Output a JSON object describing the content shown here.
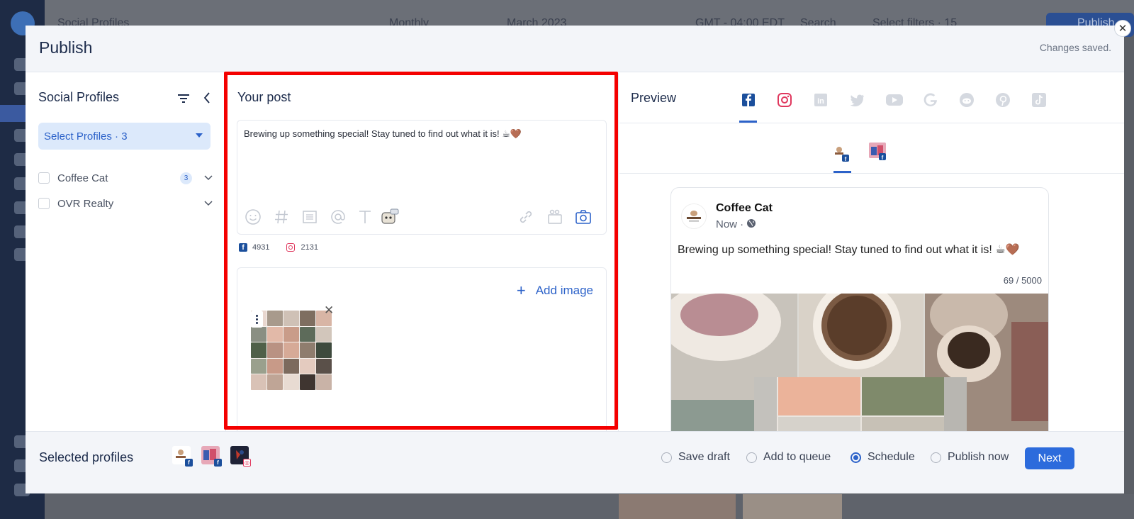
{
  "background": {
    "top_title": "Social Profiles",
    "top_view": "Monthly",
    "top_month": "March 2023",
    "top_tz": "GMT - 04:00 EDT",
    "top_search": "Search",
    "top_filters": "Select filters · 15",
    "top_publish": "Publish"
  },
  "modal": {
    "title": "Publish",
    "status": "Changes saved.",
    "close_glyph": "✕"
  },
  "left": {
    "title": "Social Profiles",
    "select_label": "Select Profiles · 3",
    "profiles": [
      {
        "name": "Coffee Cat",
        "count": "3"
      },
      {
        "name": "OVR Realty",
        "count": ""
      }
    ]
  },
  "post": {
    "title": "Your post",
    "text": "Brewing up something special! Stay tuned to find out what it is! ☕🤎",
    "fb_count": "4931",
    "ig_count": "2131",
    "add_image_label": "Add image",
    "add_image_glyph": "+",
    "tool_icons": [
      "emoji-icon",
      "hashtag-icon",
      "snippet-icon",
      "mention-icon",
      "text-format-icon",
      "ai-assistant-icon",
      "link-icon",
      "video-icon",
      "camera-icon"
    ]
  },
  "preview": {
    "title": "Preview",
    "networks": [
      "facebook",
      "instagram",
      "linkedin",
      "twitter",
      "youtube",
      "google",
      "reddit",
      "pinterest",
      "tiktok"
    ],
    "card": {
      "name": "Coffee Cat",
      "time": "Now ·",
      "text": "Brewing up something special! Stay tuned to find out what it is! ☕🤎",
      "char_count": "69 / 5000"
    }
  },
  "footer": {
    "label": "Selected profiles",
    "options": [
      {
        "label": "Save draft",
        "selected": false
      },
      {
        "label": "Add to queue",
        "selected": false
      },
      {
        "label": "Schedule",
        "selected": true
      },
      {
        "label": "Publish now",
        "selected": false
      }
    ],
    "next_label": "Next"
  },
  "colors": {
    "accent": "#2c62c9",
    "highlight": "#f40000",
    "facebook": "#1b4f9c",
    "instagram": "#e0385e"
  }
}
